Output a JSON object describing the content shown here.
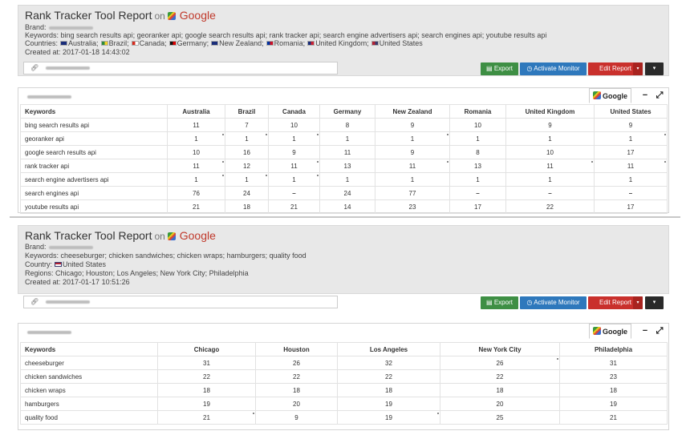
{
  "report1": {
    "title": "Rank Tracker Tool Report",
    "on": "on",
    "engine": "Google",
    "brand_label": "Brand:",
    "keywords_line": "Keywords: bing search results api; georanker api; google search results api; rank tracker api; search engine advertisers api; search engines api; youtube results api",
    "countries_label": "Countries:",
    "countries": [
      {
        "name": "Australia;",
        "flag": [
          "#1a2d7a",
          "#1a2d7a"
        ]
      },
      {
        "name": "Brazil;",
        "flag": [
          "#2e8b3e",
          "#f2d02c"
        ]
      },
      {
        "name": "Canada;",
        "flag": [
          "#d52b1e",
          "#ffffff"
        ]
      },
      {
        "name": "Germany;",
        "flag": [
          "#111111",
          "#dd0000"
        ]
      },
      {
        "name": "New Zealand;",
        "flag": [
          "#1a2d7a",
          "#1a2d7a"
        ]
      },
      {
        "name": "Romania;",
        "flag": [
          "#0033a0",
          "#ce1126"
        ]
      },
      {
        "name": "United Kingdom;",
        "flag": [
          "#1a2d7a",
          "#cc2233"
        ]
      },
      {
        "name": "United States",
        "flag": [
          "#b22234",
          "#3c3b6e"
        ]
      }
    ],
    "created": "Created at: 2017-01-18 14:43:02"
  },
  "report2": {
    "title": "Rank Tracker Tool Report",
    "on": "on",
    "engine": "Google",
    "brand_label": "Brand:",
    "keywords_line": "Keywords: cheeseburger; chicken sandwiches; chicken wraps; hamburgers; quality food",
    "country_label": "Country:",
    "country": "United States",
    "regions_line": "Regions: Chicago; Houston; Los Angeles; New York City; Philadelphia",
    "created": "Created at: 2017-01-17 10:51:26"
  },
  "toolbar": {
    "link_icon": "link-icon",
    "export_label": "Export",
    "monitor_label": "Activate Monitor",
    "edit_label": "Edit Report",
    "caret": "▾",
    "dark_caret": "▾"
  },
  "panel": {
    "tab_label": "Google",
    "minimize": "−",
    "expand": "⤢"
  },
  "table1": {
    "headers": [
      "Keywords",
      "Australia",
      "Brazil",
      "Canada",
      "Germany",
      "New Zealand",
      "Romania",
      "United Kingdom",
      "United States"
    ],
    "rows": [
      [
        "bing search results api",
        "11",
        "7",
        "10",
        "8",
        "9",
        "10",
        "9",
        "9"
      ],
      [
        "georanker api",
        "1",
        "1",
        "1",
        "1",
        "1",
        "1",
        "1",
        "1"
      ],
      [
        "google search results api",
        "10",
        "16",
        "9",
        "11",
        "9",
        "8",
        "10",
        "17"
      ],
      [
        "rank tracker api",
        "11",
        "12",
        "11",
        "13",
        "11",
        "13",
        "11",
        "11"
      ],
      [
        "search engine advertisers api",
        "1",
        "1",
        "1",
        "1",
        "1",
        "1",
        "1",
        "1"
      ],
      [
        "search engines api",
        "76",
        "24",
        "–",
        "24",
        "77",
        "–",
        "–",
        "–"
      ],
      [
        "youtube results api",
        "21",
        "18",
        "21",
        "14",
        "23",
        "17",
        "22",
        "17"
      ]
    ]
  },
  "table2": {
    "headers": [
      "Keywords",
      "Chicago",
      "Houston",
      "Los Angeles",
      "New York City",
      "Philadelphia"
    ],
    "rows": [
      [
        "cheeseburger",
        "31",
        "26",
        "32",
        "26",
        "31"
      ],
      [
        "chicken sandwiches",
        "22",
        "22",
        "22",
        "22",
        "23"
      ],
      [
        "chicken wraps",
        "18",
        "18",
        "18",
        "18",
        "18"
      ],
      [
        "hamburgers",
        "19",
        "20",
        "19",
        "20",
        "19"
      ],
      [
        "quality food",
        "21",
        "9",
        "19",
        "25",
        "21"
      ]
    ]
  }
}
